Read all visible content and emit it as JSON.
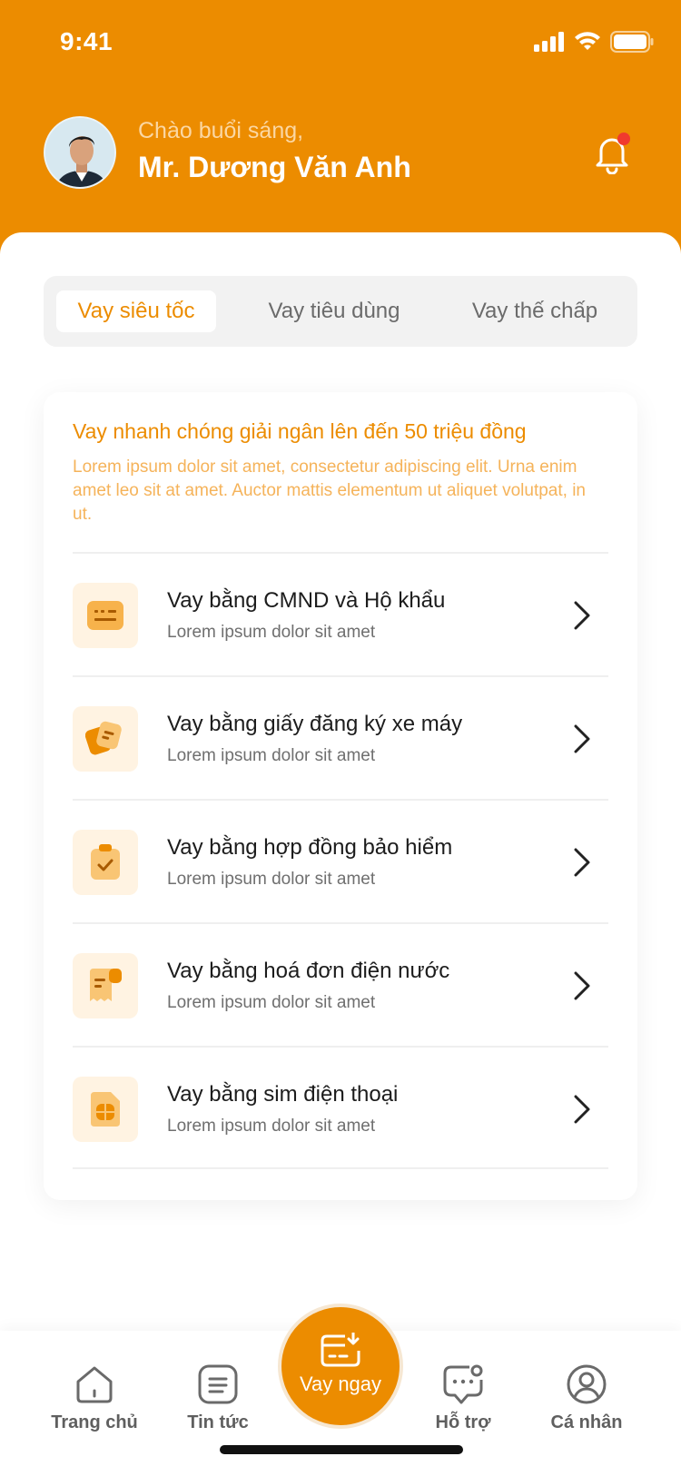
{
  "status_bar": {
    "time": "9:41"
  },
  "header": {
    "greeting": "Chào buổi sáng,",
    "user_name": "Mr. Dương Văn Anh",
    "bell_has_notification": true
  },
  "tabs": [
    {
      "label": "Vay siêu tốc",
      "active": true
    },
    {
      "label": "Vay tiêu dùng",
      "active": false
    },
    {
      "label": "Vay thế chấp",
      "active": false
    }
  ],
  "card": {
    "title": "Vay nhanh chóng giải ngân lên đến 50 triệu đồng",
    "description": "Lorem ipsum dolor sit amet, consectetur adipiscing elit. Urna enim amet leo sit at amet. Auctor mattis elementum ut aliquet volutpat, in ut."
  },
  "options": [
    {
      "title": "Vay bằng CMND và Hộ khẩu",
      "subtitle": "Lorem ipsum dolor sit amet",
      "icon": "id-card-icon"
    },
    {
      "title": "Vay bằng giấy đăng ký xe máy",
      "subtitle": "Lorem ipsum dolor sit amet",
      "icon": "documents-icon"
    },
    {
      "title": "Vay bằng hợp đồng bảo hiểm",
      "subtitle": "Lorem ipsum dolor sit amet",
      "icon": "clipboard-check-icon"
    },
    {
      "title": "Vay bằng hoá đơn điện nước",
      "subtitle": "Lorem ipsum dolor sit amet",
      "icon": "receipt-icon"
    },
    {
      "title": "Vay bằng sim điện thoại",
      "subtitle": "Lorem ipsum dolor sit amet",
      "icon": "sim-card-icon"
    }
  ],
  "bottom_nav": {
    "items": [
      {
        "label": "Trang chủ",
        "icon": "home-icon"
      },
      {
        "label": "Tin tức",
        "icon": "news-icon"
      },
      {
        "label": "Hỗ trợ",
        "icon": "chat-support-icon"
      },
      {
        "label": "Cá nhân",
        "icon": "profile-icon"
      }
    ],
    "center_button": {
      "label": "Vay ngay",
      "icon": "loan-card-icon"
    }
  },
  "colors": {
    "brand": "#EC8C00",
    "brand_light": "#FFF3E2",
    "notification_dot": "#F03A2E"
  }
}
